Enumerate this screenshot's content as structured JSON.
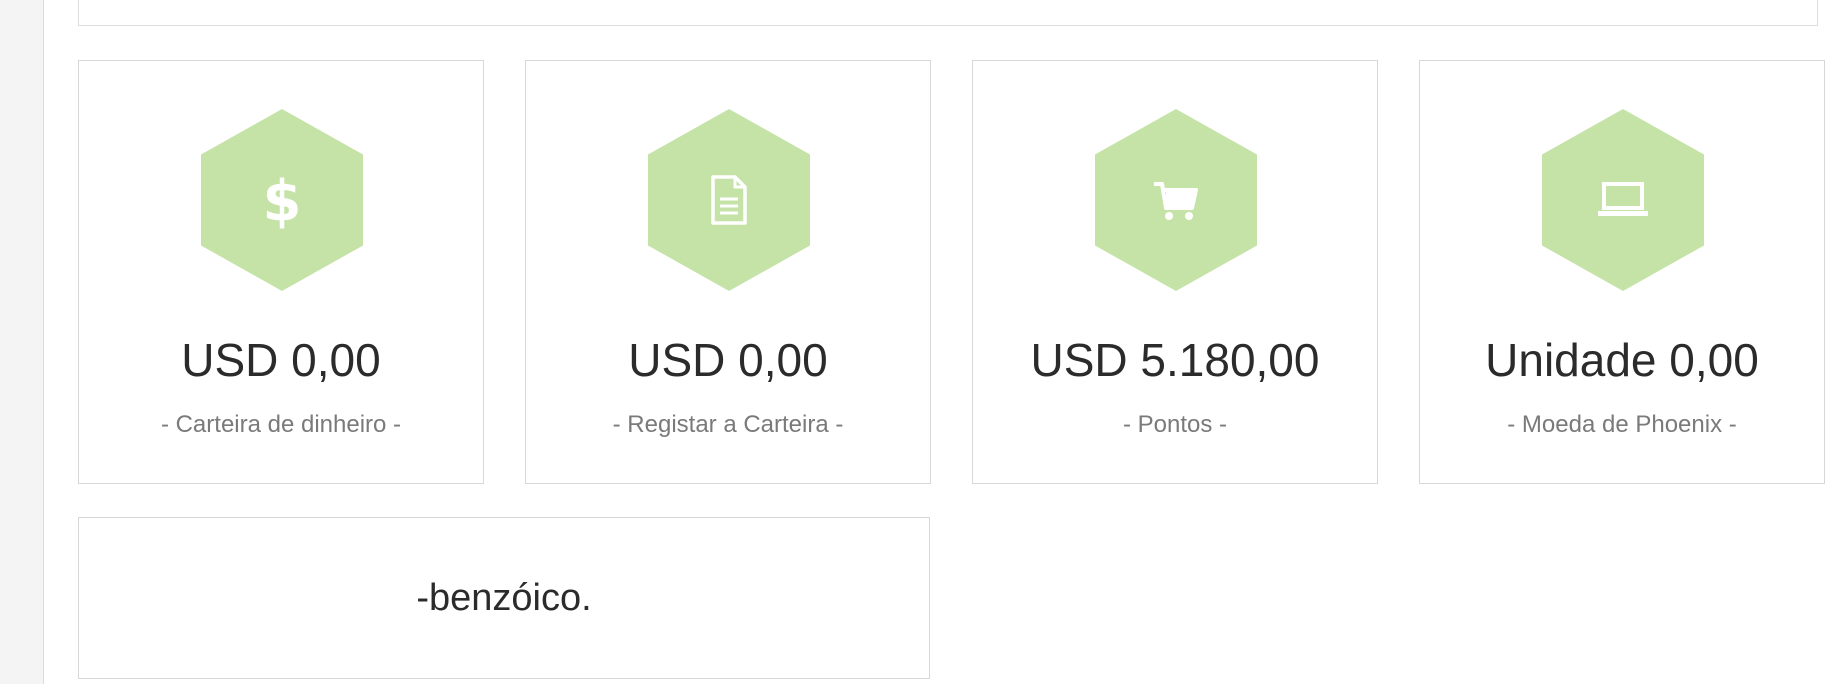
{
  "theme": {
    "hex_color": "#c6e3a7",
    "icon_color": "#ffffff"
  },
  "cards": [
    {
      "icon": "dollar-icon",
      "amount": "USD 0,00",
      "caption": "- Carteira de dinheiro -"
    },
    {
      "icon": "document-icon",
      "amount": "USD 0,00",
      "caption": "- Registar a Carteira -"
    },
    {
      "icon": "shopping-cart-icon",
      "amount": "USD 5.180,00",
      "caption": "- Pontos -"
    },
    {
      "icon": "laptop-icon",
      "amount": "Unidade 0,00",
      "caption": "- Moeda de Phoenix -"
    }
  ],
  "note": {
    "text": "-benzóico."
  }
}
